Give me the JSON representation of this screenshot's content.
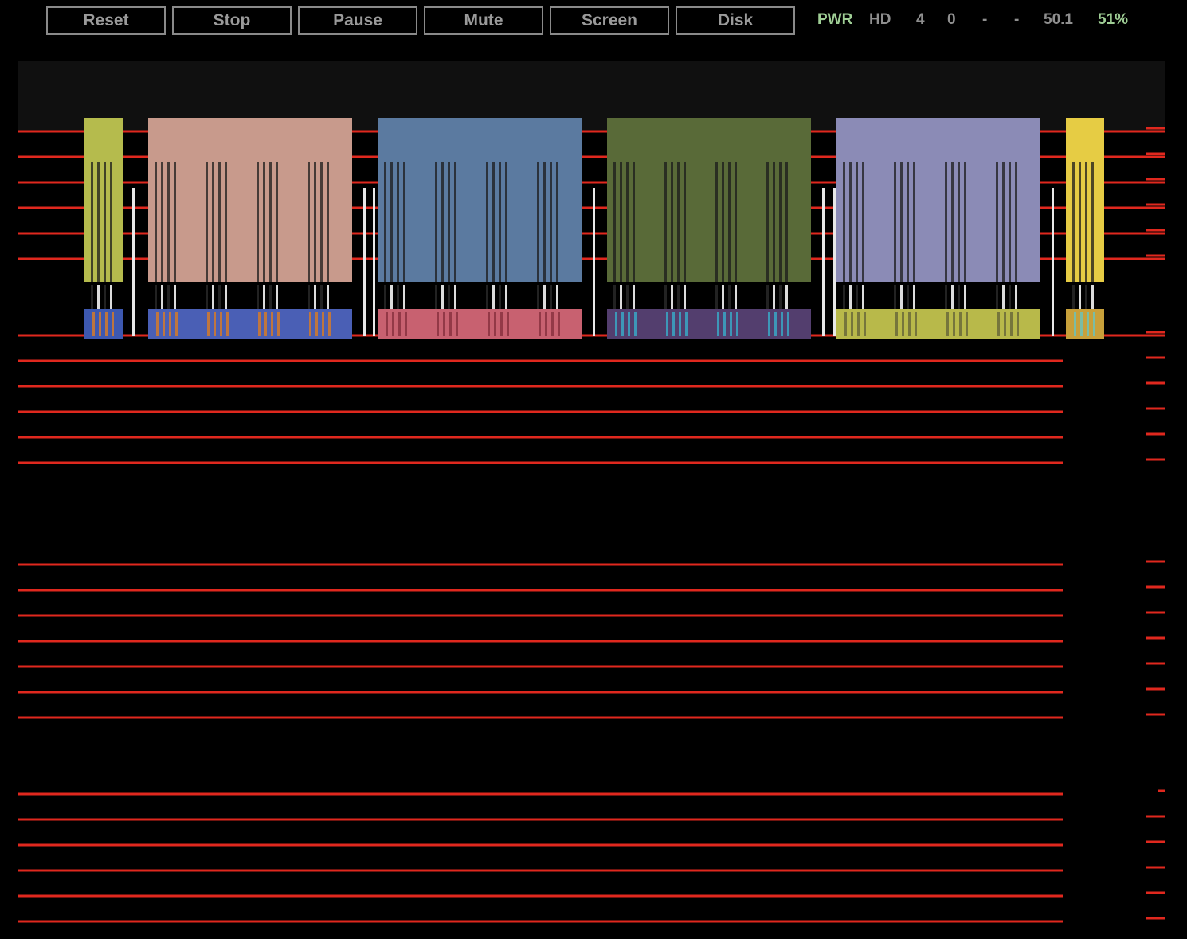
{
  "toolbar": {
    "buttons": {
      "reset": "Reset",
      "stop": "Stop",
      "pause": "Pause",
      "mute": "Mute",
      "screen": "Screen",
      "disk": "Disk"
    }
  },
  "status": {
    "pwr": "PWR",
    "hd": "HD",
    "field1": "4",
    "field2": "0",
    "field3": "-",
    "field4": "-",
    "speed": "50.1",
    "percent": "51%"
  },
  "colors": {
    "background": "#000000",
    "top_band": "#101010",
    "scanline_red": "#e0281e",
    "status_green": "#9fce95",
    "button_text": "#9a9a9a",
    "button_border": "#8a8a8a"
  }
}
